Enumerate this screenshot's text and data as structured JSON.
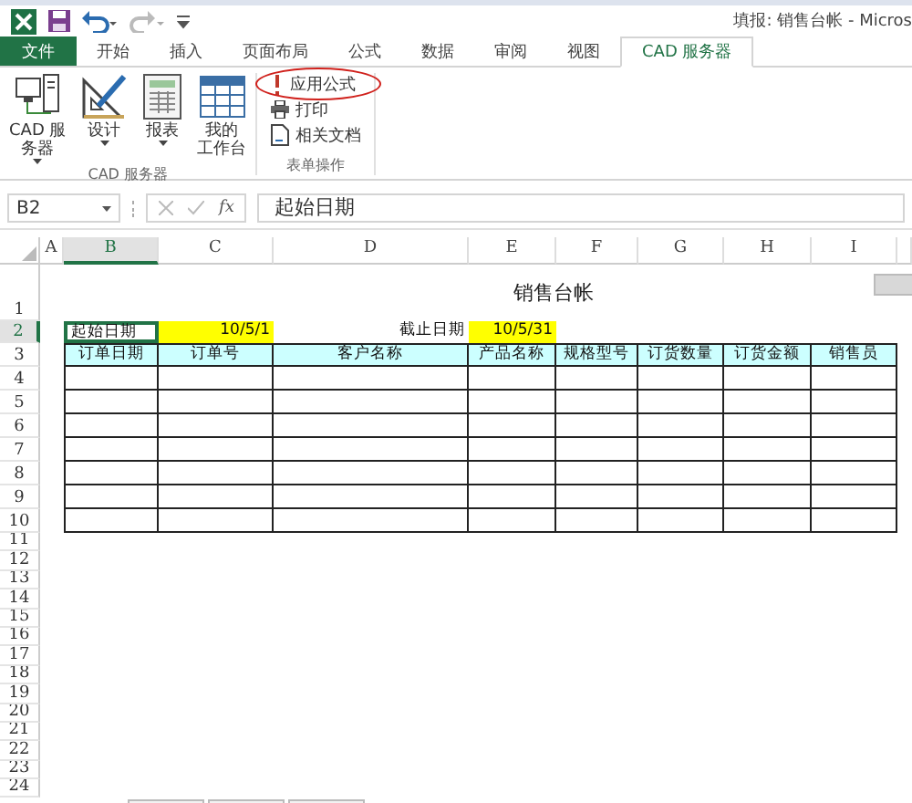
{
  "title_bar": {
    "title": "填报: 销售台帐 - Micros"
  },
  "ribbon_tabs": [
    {
      "label": "文件",
      "kind": "file",
      "selected": false
    },
    {
      "label": "开始",
      "kind": "tab",
      "selected": false
    },
    {
      "label": "插入",
      "kind": "tab",
      "selected": false
    },
    {
      "label": "页面布局",
      "kind": "tab",
      "selected": false
    },
    {
      "label": "公式",
      "kind": "tab",
      "selected": false
    },
    {
      "label": "数据",
      "kind": "tab",
      "selected": false
    },
    {
      "label": "审阅",
      "kind": "tab",
      "selected": false
    },
    {
      "label": "视图",
      "kind": "tab",
      "selected": false
    },
    {
      "label": "CAD 服务器",
      "kind": "tab",
      "selected": true
    }
  ],
  "ribbon_groups": [
    {
      "label": "CAD 服务器",
      "kind": "large",
      "buttons": [
        {
          "lines": [
            "CAD 服",
            "务器"
          ],
          "kind": "server",
          "dropdown": true
        },
        {
          "lines": [
            "设计"
          ],
          "kind": "design",
          "dropdown": true
        },
        {
          "lines": [
            "报表"
          ],
          "kind": "report",
          "dropdown": true
        },
        {
          "lines": [
            "我的",
            "工作台"
          ],
          "kind": "workspace",
          "dropdown": false
        }
      ]
    },
    {
      "label": "表单操作",
      "kind": "small",
      "buttons": [
        {
          "lines": [
            "应用公式"
          ],
          "kind": "formula",
          "highlighted": true
        },
        {
          "lines": [
            "打印"
          ],
          "kind": "print",
          "highlighted": false
        },
        {
          "lines": [
            "相关文档"
          ],
          "kind": "document",
          "highlighted": false
        }
      ]
    }
  ],
  "formula_bar": {
    "name_box": "B2",
    "insert_function": "fx",
    "value": "起始日期"
  },
  "sheet": {
    "columns": [
      "A",
      "B",
      "C",
      "D",
      "E",
      "F",
      "G",
      "H",
      "I"
    ],
    "rows": [
      {
        "number": "1",
        "kind": "title",
        "title": "销售台帐"
      },
      {
        "number": "2",
        "kind": "dates",
        "cells": [
          {
            "text": "起始日期",
            "kind": "label",
            "selected": true
          },
          {
            "text": "10/5/1",
            "kind": "date",
            "selected": false
          },
          {
            "text": "截止日期",
            "kind": "label",
            "selected": false
          },
          {
            "text": "10/5/31",
            "kind": "date",
            "selected": false
          }
        ]
      },
      {
        "number": "3",
        "kind": "table_header",
        "cells": [
          "订单日期",
          "订单号",
          "客户名称",
          "产品名称",
          "规格型号",
          "订货数量",
          "订货金额",
          "销售员"
        ]
      },
      {
        "number": "4",
        "kind": "table_row"
      },
      {
        "number": "5",
        "kind": "table_row"
      },
      {
        "number": "6",
        "kind": "table_row"
      },
      {
        "number": "7",
        "kind": "table_row"
      },
      {
        "number": "8",
        "kind": "table_row"
      },
      {
        "number": "9",
        "kind": "table_row"
      },
      {
        "number": "10",
        "kind": "table_row"
      },
      {
        "number": "11",
        "kind": "blank"
      },
      {
        "number": "12",
        "kind": "blank"
      },
      {
        "number": "13",
        "kind": "blank"
      },
      {
        "number": "14",
        "kind": "blank"
      },
      {
        "number": "15",
        "kind": "blank"
      },
      {
        "number": "16",
        "kind": "blank"
      },
      {
        "number": "17",
        "kind": "blank"
      },
      {
        "number": "18",
        "kind": "blank"
      },
      {
        "number": "19",
        "kind": "blank"
      },
      {
        "number": "20",
        "kind": "blank"
      },
      {
        "number": "21",
        "kind": "blank"
      },
      {
        "number": "22",
        "kind": "blank"
      },
      {
        "number": "23",
        "kind": "blank"
      },
      {
        "number": "24",
        "kind": "blank"
      }
    ]
  }
}
